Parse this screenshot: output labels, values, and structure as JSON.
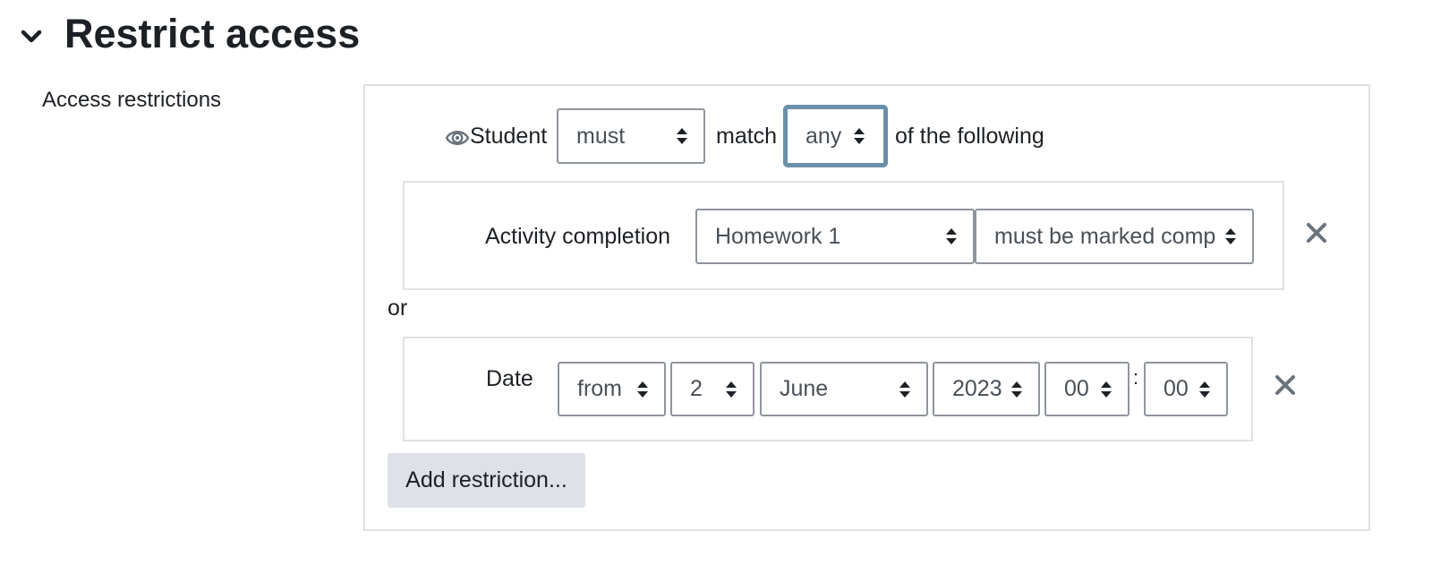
{
  "section": {
    "title": "Restrict access"
  },
  "field_label": "Access restrictions",
  "header": {
    "student_label": "Student",
    "must_select": "must",
    "match_label": "match",
    "any_select": "any",
    "following_label": "of the following"
  },
  "restrictions": [
    {
      "type_label": "Activity completion",
      "activity": "Homework 1",
      "condition": "must be marked comp"
    },
    {
      "type_label": "Date",
      "direction": "from",
      "day": "2",
      "month": "June",
      "year": "2023",
      "hour": "00",
      "minute": "00",
      "time_separator": ":"
    }
  ],
  "connector": "or",
  "add_button": "Add restriction...",
  "icons": {
    "collapse": "chevron-down-icon",
    "visibility": "eye-icon",
    "delete": "close-icon",
    "select": "sort-arrows-icon"
  },
  "colors": {
    "focus_border": "#6a8fab",
    "box_border": "#dee2e6",
    "button_bg": "#dee2e6",
    "icon": "#6a737b"
  }
}
